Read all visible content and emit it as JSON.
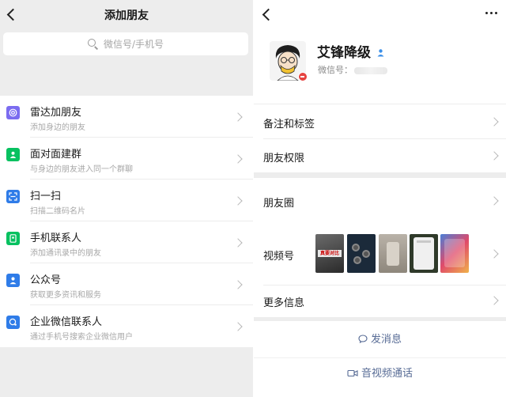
{
  "left_page": {
    "title": "添加朋友",
    "search_placeholder": "微信号/手机号",
    "items": [
      {
        "title": "雷达加朋友",
        "subtitle": "添加身边的朋友",
        "icon": "radar-icon",
        "color": "#7b6cf0"
      },
      {
        "title": "面对面建群",
        "subtitle": "与身边的朋友进入同一个群聊",
        "icon": "face-to-face-group-icon",
        "color": "#07c160"
      },
      {
        "title": "扫一扫",
        "subtitle": "扫描二维码名片",
        "icon": "scan-icon",
        "color": "#2f7ce8"
      },
      {
        "title": "手机联系人",
        "subtitle": "添加通讯录中的朋友",
        "icon": "phone-contacts-icon",
        "color": "#07c160"
      },
      {
        "title": "公众号",
        "subtitle": "获取更多资讯和服务",
        "icon": "official-account-icon",
        "color": "#2f7ce8"
      },
      {
        "title": "企业微信联系人",
        "subtitle": "通过手机号搜索企业微信用户",
        "icon": "wecom-contact-icon",
        "color": "#2f7ce8"
      }
    ]
  },
  "right_page": {
    "name": "艾锋降级",
    "wechat_id_label": "微信号：",
    "rows": {
      "remark_tags": "备注和标签",
      "friend_permissions": "朋友权限",
      "moments": "朋友圈",
      "channels": "视频号",
      "more_info": "更多信息"
    },
    "channel_thumb_text": "真要对比",
    "send_message": "发消息",
    "video_call": "音视频通话"
  },
  "colors": {
    "accent_link": "#576b95",
    "page_bg": "#ededed",
    "card_bg": "#ffffff",
    "wechat_green": "#07c160"
  }
}
